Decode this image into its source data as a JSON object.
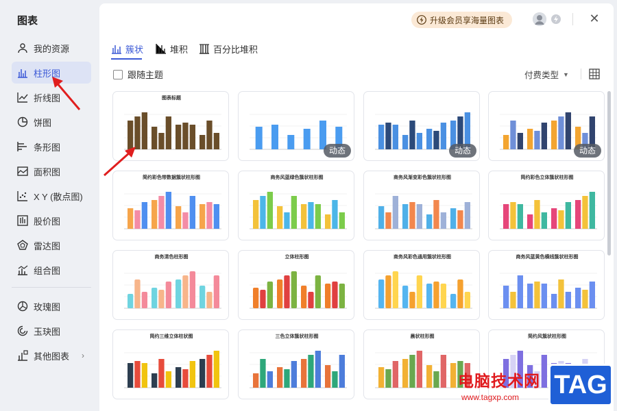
{
  "sidebar": {
    "title": "图表",
    "items": [
      {
        "label": "我的资源",
        "icon": "user-icon"
      },
      {
        "label": "柱形图",
        "icon": "bar-chart-icon",
        "active": true
      },
      {
        "label": "折线图",
        "icon": "line-chart-icon"
      },
      {
        "label": "饼图",
        "icon": "pie-chart-icon"
      },
      {
        "label": "条形图",
        "icon": "horizontal-bar-icon"
      },
      {
        "label": "面积图",
        "icon": "area-chart-icon"
      },
      {
        "label": "X Y (散点图)",
        "icon": "scatter-icon"
      },
      {
        "label": "股价图",
        "icon": "stock-chart-icon"
      },
      {
        "label": "雷达图",
        "icon": "radar-icon"
      },
      {
        "label": "组合图",
        "icon": "combo-chart-icon"
      },
      {
        "label": "玫瑰图",
        "icon": "rose-chart-icon"
      },
      {
        "label": "玉玦图",
        "icon": "ring-chart-icon"
      },
      {
        "label": "其他图表",
        "icon": "other-chart-icon",
        "arrow": "›"
      }
    ]
  },
  "header": {
    "vip_label": "升级会员享海量图表",
    "close": "✕"
  },
  "tabs": [
    {
      "label": "簇状",
      "active": true
    },
    {
      "label": "堆积"
    },
    {
      "label": "百分比堆积"
    }
  ],
  "filter": {
    "follow_theme": "跟随主题",
    "pay_type": "付费类型",
    "caret": "▼"
  },
  "cards": [
    {
      "title": "图表标题",
      "badge": ""
    },
    {
      "title": "",
      "badge": "动态"
    },
    {
      "title": "",
      "badge": "动态"
    },
    {
      "title": "",
      "badge": "动态"
    },
    {
      "title": "简约彩色带数据簇状柱形图",
      "badge": ""
    },
    {
      "title": "商务风蓝绿色簇状柱形图",
      "badge": ""
    },
    {
      "title": "商务风渐变彩色簇状柱形图",
      "badge": ""
    },
    {
      "title": "简约彩色立体簇状柱形图",
      "badge": ""
    },
    {
      "title": "商务清色柱形图",
      "badge": ""
    },
    {
      "title": "立体柱形图",
      "badge": ""
    },
    {
      "title": "商务风彩色通用簇状柱形图",
      "badge": ""
    },
    {
      "title": "商务风蓝黄色横线簇状柱形图",
      "badge": ""
    },
    {
      "title": "简约三维立体柱状图",
      "badge": ""
    },
    {
      "title": "三色立体簇状柱形图",
      "badge": ""
    },
    {
      "title": "晨状柱形图",
      "badge": ""
    },
    {
      "title": "简约风簇状柱形图",
      "badge": ""
    }
  ],
  "watermark": {
    "site_name": "电脑技术网",
    "url": "www.tagxp.com",
    "tag": "TAG"
  }
}
